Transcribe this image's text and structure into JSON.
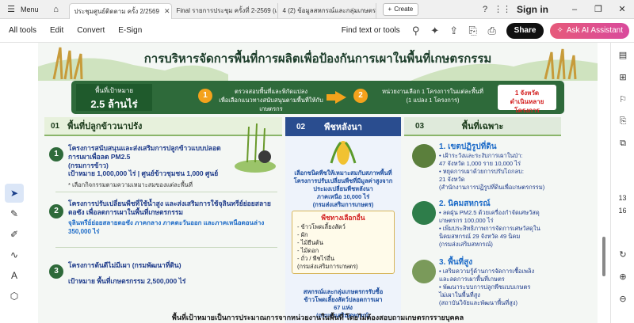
{
  "titlebar": {
    "menu_label": "Menu",
    "tabs": [
      {
        "label": "ประชุมศูนย์ติดตาม ครั้ง 2/2569",
        "active": true
      },
      {
        "label": "Final รายการประชุม ครั้งที่ 2-2569 (เติม...",
        "active": false
      },
      {
        "label": "4 (2) ข้อมูลสหกรณ์และกลุ่มเกษตรกรที่ปร...",
        "active": false
      }
    ],
    "create_label": "Create",
    "signin_label": "Sign in"
  },
  "menubar": {
    "items": [
      "All tools",
      "Edit",
      "Convert",
      "E-Sign"
    ],
    "find_label": "Find text or tools",
    "share_label": "Share",
    "ai_label": "Ask AI Assistant"
  },
  "sidebar_right": {
    "page_current": "13",
    "page_total": "16"
  },
  "doc": {
    "title": "การบริหารจัดการพื้นที่การผลิตเพื่อป้องกันการเผาในพื้นที่เกษตรกรรม",
    "banner": {
      "target_label": "พื้นที่เป้าหมาย",
      "target_value": "2.5 ล้านไร่",
      "step1_num": "1",
      "step1_text": "ตรวจสอบพื้นที่และพิกัดแปลง\nเพื่อเลือกแนวทางสนับสนุนตามพื้นที่ให้กับเกษตรกร",
      "step2_num": "2",
      "step2_text": "หน่วยงานเลือก 1 โครงการในแต่ละพื้นที่\n(1 แปลง 1 โครงการ)",
      "red_box": "1 จังหวัด\nดำเนินหลายโครงการ"
    },
    "col1": {
      "num": "01",
      "header": "พื้นที่ปลูกข้าวนาปรัง",
      "items": [
        {
          "num": "1",
          "title": "โครงการสนับสนุนและส่งเสริมการปลูกข้าวแบบปลอดการเผาเพื่อลด PM2.5\n(กรมการข้าว)",
          "goal": "เป้าหมาย  1,000,000 ไร่  |  ศูนย์ข้าวชุมชน 1,000 ศูนย์",
          "note": "* เลือกกิจกรรมตามความเหมาะสมของแต่ละพื้นที่"
        },
        {
          "num": "2",
          "title": "โครงการปรับเปลี่ยนพืชที่ใช้น้ำสูง และส่งเสริมการใช้จุลินทรีย์ย่อยสลาย\nตอซัง เพื่อลดการเผาในพื้นที่เกษตรกรรม",
          "blue": "จุลินทรีย์ย่อยสลายตอซัง ภาคกลาง ภาคตะวันออก และภาคเหนือตอนล่าง\n350,000 ไร่"
        },
        {
          "num": "3",
          "title": "โครงการต้นดีไม่มีเผา (กรมพัฒนาที่ดิน)",
          "goal": "เป้าหมาย  พื้นที่เกษตรกรรม 2,500,000 ไร่"
        }
      ]
    },
    "col2": {
      "num": "02",
      "header": "พืชหลังนา",
      "text1": "เลือกชนิดพืชให้เหมาะสมกับสภาพพื้นที่\nโครงการปรับเปลี่ยนพืชที่มีมูลค่าสูงจาก\nประมงเปลี่ยนพืชหลังนา\nภาคเหนือ 10,000 ไร่\n(กรมส่งเสริมการเกษตร)",
      "options_title": "พืชทางเลือกอื่น",
      "options": [
        "- ข้าวโพดเลี้ยงสัตว์",
        "- ผัก",
        "- ไม้ยืนต้น",
        "- ไม้ดอก",
        "- ถั่ว / พืชไร่อื่น",
        "(กรมส่งเสริมการเกษตร)"
      ],
      "text2": "สหกรณ์และกลุ่มเกษตรกรรับซื้อ\nข้าวโพดเลี้ยงสัตว์ปลอดการเผา\n67 แห่ง\n(กรมส่งเสริมสหกรณ์)"
    },
    "col3": {
      "num": "03",
      "header": "พื้นที่เฉพาะ",
      "items": [
        {
          "title": "1. เขตปฏิรูปที่ดิน",
          "text": "• เฝ้าระวังและระงับการเผาในป่า:\n  47 จังหวัด 1,000 ราย 10,000 ไร่\n• หยุดการเผาด้วยการปรับไถกลบ:\n  21 จังหวัด\n(สำนักงานการปฏิรูปที่ดินเพื่อเกษตรกรรม)"
        },
        {
          "title": "2. นิคมสหกรณ์",
          "text": "• ลดฝุ่น PM2.5 ด้วยเครื่องกำจัดเศษวัสดุ\n  เกษตรกร 100,000 ไร่\n• เพิ่มประสิทธิภาพการจัดการเศษวัสดุใน\n  นิคมสหกรณ์ 29 จังหวัด 49 นิคม\n(กรมส่งเสริมสหกรณ์)"
        },
        {
          "title": "3. พื้นที่สูง",
          "text": "• เสริมความรู้ด้านการจัดการเชื้อเพลิง\n  และลดการเผาพื้นที่เกษตร\n• พัฒนาระบบการปลูกพืชแบบเกษตร\n  ไม่เผาในพื้นที่สูง\n(สถาบันวิจัยและพัฒนาพื้นที่สูง)"
        }
      ]
    },
    "footer": "พื้นที่เป้าหมายเป็นการประมาณการจากหน่วยงานในพื้นที่ โดยไม่ต้องสอบถามเกษตรกรรายบุคคล"
  },
  "icons": [
    "menu-icon",
    "home-icon",
    "close-icon",
    "plus-icon",
    "help-icon",
    "minimize-icon",
    "maximize-icon",
    "window-close-icon",
    "search-tools-icon",
    "print-icon",
    "cursor-icon",
    "comment-icon",
    "highlight-icon",
    "draw-icon",
    "text-icon",
    "stamp-icon",
    "zoom-in-icon",
    "zoom-out-icon"
  ]
}
